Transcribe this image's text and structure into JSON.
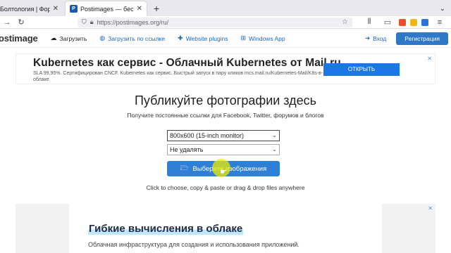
{
  "browser": {
    "tabs": [
      {
        "title": "Болтология | Форумы VINEYAR",
        "active": false
      },
      {
        "title": "Postimages — бесплатный хо",
        "active": true
      }
    ],
    "new_tab": "+",
    "tab_list": "⌄",
    "url": "https://postimages.org/ru/"
  },
  "site": {
    "logo": "ostimage",
    "nav": [
      {
        "label": "Загрузить",
        "icon": "cloud-upload-icon"
      },
      {
        "label": "Загрузить по ссылке",
        "icon": "globe-icon"
      },
      {
        "label": "Website plugins",
        "icon": "puzzle-icon"
      },
      {
        "label": "Windows App",
        "icon": "windows-icon"
      }
    ],
    "login": "Вход",
    "register": "Регистрация"
  },
  "ad_top": {
    "title": "Kubernetes как сервис - Облачный Kubernetes от Mail.ru",
    "text": "SLA 99,95%. Сертифицирован CNCF. Kubernetes как сервис. Быстрый запуск в пару кликов mcs.mail.ru/Kubernetes-Mail/K8s-в-облаке",
    "button": "ОТКРЫТЬ"
  },
  "main": {
    "headline": "Публикуйте фотографии здесь",
    "subline": "Получите постоянные ссылки для Facebook, Twitter, форумов и блогов",
    "size_select": "800x600 (15-inch monitor)",
    "expire_select": "Не удалять",
    "upload_button": "Выберите изображения",
    "hint": "Click to choose, copy & paste or drag & drop files anywhere"
  },
  "ad_bottom": {
    "title": "Гибкие вычисления в облаке",
    "text": "Облачная инфраструктура для создания и использования приложений."
  },
  "colors": {
    "accent": "#2e7fd6",
    "ad_button": "#1a78e6",
    "highlight": "#ebeb00"
  }
}
